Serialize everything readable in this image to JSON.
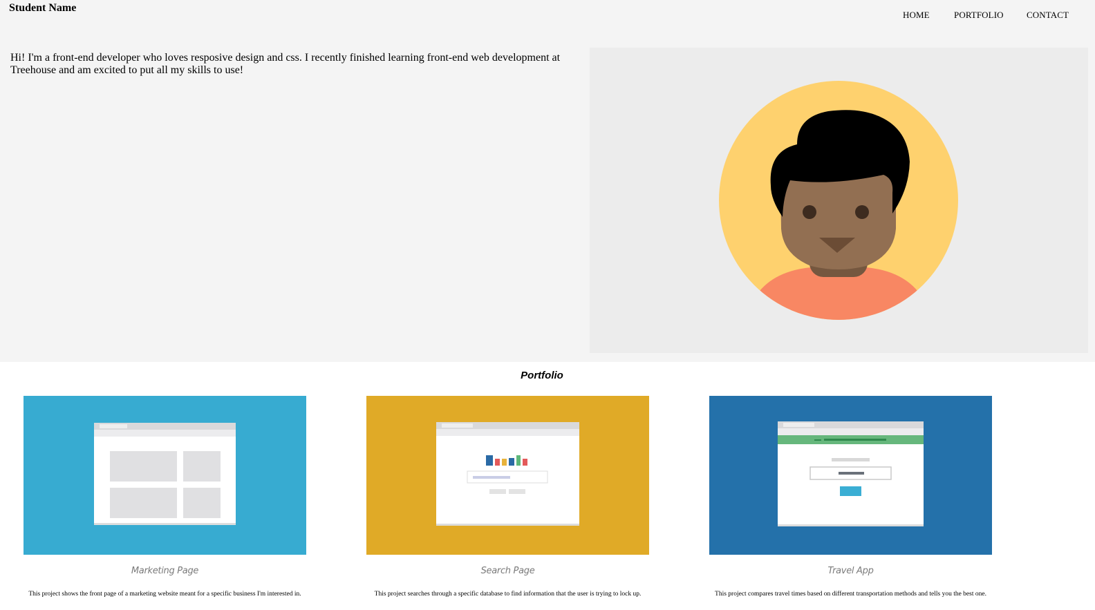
{
  "header": {
    "brand": "Student Name",
    "nav": [
      {
        "label": "HOME"
      },
      {
        "label": "PORTFOLIO"
      },
      {
        "label": "CONTACT"
      }
    ]
  },
  "intro": {
    "text": "Hi! I'm a front-end developer who loves resposive design and css. I recently finished learning front-end web development at Treehouse and am excited to put all my skills to use!"
  },
  "portfolio": {
    "title": "Portfolio",
    "projects": [
      {
        "name": "Marketing Page",
        "description": "This project shows the front page of a marketing website meant for a specific business I'm interested in.",
        "color": "#37abd1",
        "icon": "marketing-page-thumbnail"
      },
      {
        "name": "Search Page",
        "description": "This project searches through a specific database to find information that the user is trying to lock up.",
        "color": "#e0aa27",
        "icon": "search-page-thumbnail"
      },
      {
        "name": "Travel App",
        "description": "This project compares travel times based on different transportation methods and tells you the best one.",
        "color": "#2471aa",
        "icon": "travel-app-thumbnail"
      }
    ]
  },
  "colors": {
    "top_background": "#f4f4f4",
    "hero_background": "#ececec",
    "avatar_circle": "#fed16e",
    "avatar_shirt": "#f88763",
    "avatar_skin": "#926f52"
  }
}
